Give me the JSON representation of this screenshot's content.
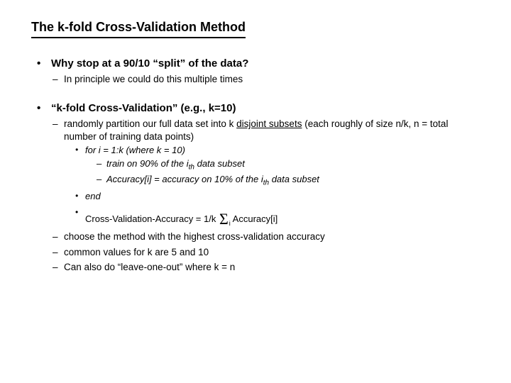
{
  "title": "The k-fold Cross-Validation Method",
  "b1": {
    "head": "Why stop at a 90/10 “split” of the data?",
    "d1": "In principle we could do this multiple times"
  },
  "b2": {
    "head": "“k-fold Cross-Validation” (e.g., k=10)",
    "d1a": "randomly partition our full data set into k ",
    "d1b": "disjoint subsets",
    "d1c": " (each roughly of size n/k, n = total number of training data points)",
    "dot1": "for i = 1:k  (where k = 10)",
    "dd1a": "train on 90% of the i",
    "dd1b": "th",
    "dd1c": " data subset",
    "dd2a": "Accuracy[i] =  accuracy on 10% of the i",
    "dd2b": "th",
    "dd2c": " data subset",
    "dot2": "end",
    "dot3a": "Cross-Validation-Accuracy =  1/k  ",
    "dot3b": "i",
    "dot3c": "  Accuracy[i]",
    "d2": "choose the method with the highest cross-validation accuracy",
    "d3": "common values for k are 5 and 10",
    "d4": "Can also do “leave-one-out” where k = n"
  }
}
